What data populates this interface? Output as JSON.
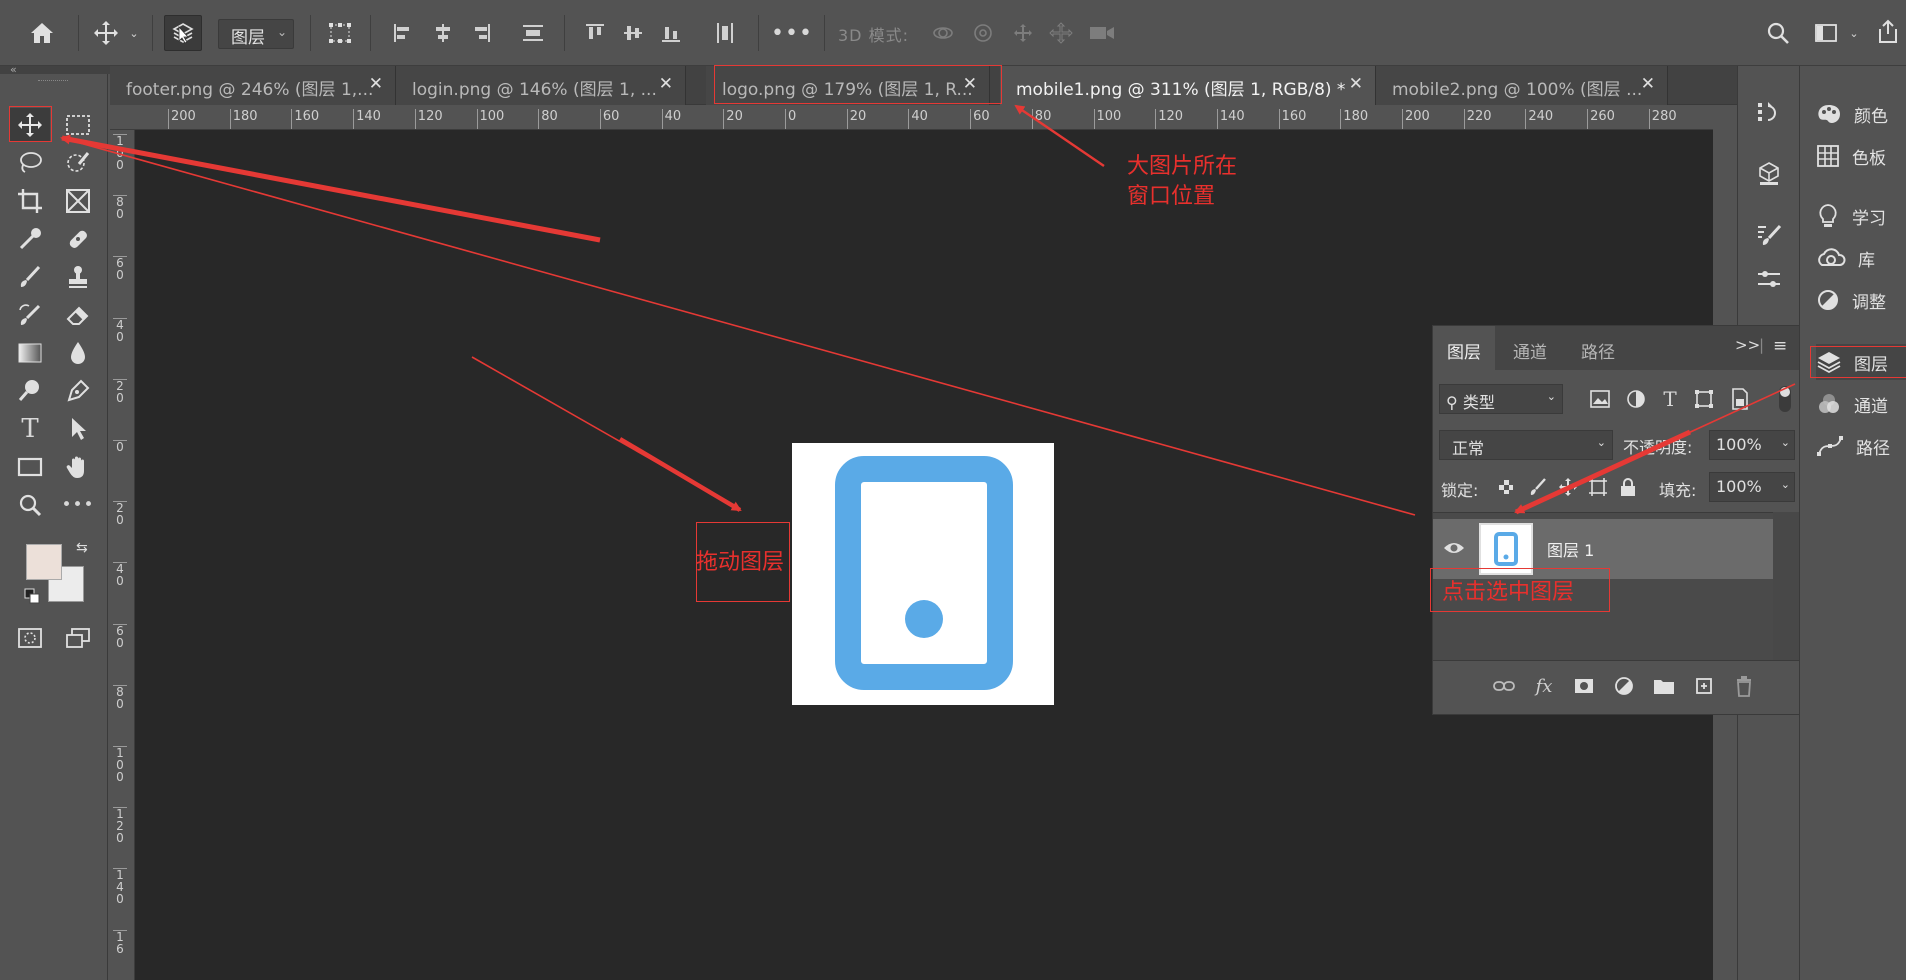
{
  "options_bar": {
    "layer_select": "图层",
    "mode_3d_label": "3D 模式:",
    "icons": [
      "home-icon",
      "move-icon",
      "auto-select-icon",
      "transform-controls-icon",
      "align-left-icon",
      "align-hcenter-icon",
      "align-right-icon",
      "distribute-icon",
      "align-top-icon",
      "align-vcenter-icon",
      "align-bottom-icon",
      "distribute-v-icon",
      "more-icon",
      "orbit-3d-icon",
      "roll-3d-icon",
      "drag-3d-icon",
      "slide-3d-icon",
      "camera-3d-icon",
      "search-icon",
      "workspace-icon",
      "share-icon"
    ]
  },
  "tabs": [
    {
      "label": "footer.png @ 246% (图层 1,...",
      "active": false
    },
    {
      "label": "login.png @ 146% (图层 1, ...",
      "active": false
    },
    {
      "label": "logo.png @ 179% (图层 1, R...",
      "active": false
    },
    {
      "label": "mobile1.png @ 311% (图层 1, RGB/8) *",
      "active": true
    },
    {
      "label": "mobile2.png @ 100% (图层 ...",
      "active": false
    }
  ],
  "ruler_h_labels": [
    "200",
    "180",
    "160",
    "140",
    "120",
    "100",
    "80",
    "60",
    "40",
    "20",
    "0",
    "20",
    "40",
    "60",
    "80",
    "100",
    "120",
    "140",
    "160",
    "180",
    "200",
    "220",
    "240",
    "260",
    "280"
  ],
  "ruler_v_labels": [
    "1 0 0",
    "8 0",
    "6 0",
    "4 0",
    "2 0",
    "0",
    "2 0",
    "4 0",
    "6 0",
    "8 0",
    "1 0 0",
    "1 2 0",
    "1 4 0",
    "1 6"
  ],
  "right_panels": [
    {
      "label": "颜色",
      "icon": "color-palette-icon"
    },
    {
      "label": "色板",
      "icon": "swatches-grid-icon"
    },
    {
      "label": "学习",
      "icon": "lightbulb-icon"
    },
    {
      "label": "库",
      "icon": "libraries-icon"
    },
    {
      "label": "调整",
      "icon": "adjustments-icon"
    },
    {
      "label": "图层",
      "icon": "layers-icon"
    },
    {
      "label": "通道",
      "icon": "channels-icon"
    },
    {
      "label": "路径",
      "icon": "paths-icon"
    }
  ],
  "layers_panel": {
    "tabs": [
      "图层",
      "通道",
      "路径"
    ],
    "filter_kind": "类型",
    "blend_mode": "正常",
    "opacity_label": "不透明度:",
    "opacity_value": "100%",
    "lock_label": "锁定:",
    "fill_label": "填充:",
    "fill_value": "100%",
    "layer_name": "图层 1"
  },
  "annotations": {
    "tab_note_line1": "大图片所在",
    "tab_note_line2": "窗口位置",
    "drag_note": "拖动图层",
    "click_note": "点击选中图层"
  },
  "colors": {
    "annotation_red": "#e53935",
    "icon_blue": "#5aaae7",
    "canvas_bg": "#282828",
    "ui_gray": "#535353"
  }
}
